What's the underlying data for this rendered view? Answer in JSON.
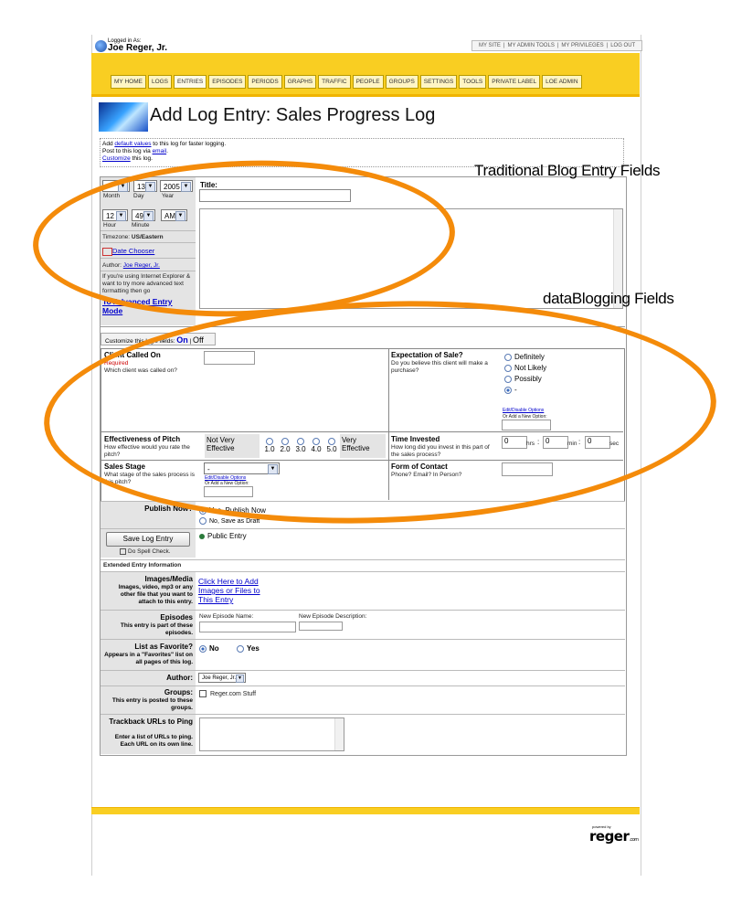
{
  "header": {
    "logged_in_label": "Logged in As:",
    "username": "Joe Reger, Jr.",
    "links": [
      "MY SITE",
      "MY ADMIN TOOLS",
      "MY PRIVILEGES",
      "LOG OUT"
    ]
  },
  "nav": {
    "tabs": [
      "MY HOME",
      "LOGS",
      "ENTRIES",
      "EPISODES",
      "PERIODS",
      "GRAPHS",
      "TRAFFIC",
      "PEOPLE",
      "GROUPS",
      "SETTINGS",
      "TOOLS",
      "PRIVATE LABEL",
      "LOE ADMIN"
    ],
    "active": "ENTRIES"
  },
  "page_title": "Add Log Entry: Sales Progress Log",
  "info": {
    "line1_pre": "Add ",
    "line1_link": "default values",
    "line1_post": " to this log for faster logging.",
    "line2_pre": "Post to this log via ",
    "line2_link": "email",
    "line2_post": ".",
    "line3_link": "Customize",
    "line3_post": " this log."
  },
  "datetime": {
    "month_value": "",
    "day_value": "13",
    "year_value": "2005",
    "month_label": "Month",
    "day_label": "Day",
    "year_label": "Year",
    "hour_value": "12",
    "minute_value": "49",
    "ampm_value": "AM",
    "hour_label": "Hour",
    "minute_label": "Minute",
    "timezone_label": "Timezone:",
    "timezone_value": "US/Eastern",
    "date_chooser": "Date Chooser",
    "author_label": "Author:",
    "author_value": "Joe Reger, Jr.",
    "ie_note": "If you're using Internet Explorer & want to try more advanced text formatting then go",
    "advanced_link": "To Advanced Entry Mode"
  },
  "title_field": {
    "label": "Title:",
    "value": ""
  },
  "customize_fields": {
    "label": "Customize this log's fields:",
    "on": "On",
    "separator": "|",
    "off": "Off"
  },
  "fields": {
    "client_called": {
      "label": "Client Called On",
      "required": "Required",
      "desc": "Which client was called on?"
    },
    "expectation": {
      "label": "Expectation of Sale?",
      "desc": "Do you believe this client will make a purchase?",
      "options": [
        "Definitely",
        "Not Likely",
        "Possibly",
        "-"
      ],
      "selected": "-",
      "edit_link": "Edit/Disable Options",
      "add_label": "Or Add a New Option:"
    },
    "effectiveness": {
      "label": "Effectiveness of Pitch",
      "desc": "How effective would you rate the pitch?",
      "low_label": "Not Very Effective",
      "high_label": "Very Effective",
      "scale": [
        "1.0",
        "2.0",
        "3.0",
        "4.0",
        "5.0"
      ]
    },
    "time_invested": {
      "label": "Time Invested",
      "desc": "How long did you invest in this part of the sales process?",
      "hrs_value": "0",
      "hrs_unit": "hrs",
      "min_value": "0",
      "min_unit": "min",
      "sec_value": "0",
      "sec_unit": "sec",
      "sep": ":"
    },
    "sales_stage": {
      "label": "Sales Stage",
      "desc": "What stage of the sales process is this pitch?",
      "value": "-",
      "edit_link": "Edit/Disable Options",
      "add_label": "Or Add a New Option:"
    },
    "form_of_contact": {
      "label": "Form of Contact",
      "desc": "Phone? Email? In Person?"
    }
  },
  "publish": {
    "label": "Publish Now?",
    "option_yes": "Yes, Publish Now",
    "option_no": "No, Save as Draft",
    "selected": "yes"
  },
  "save": {
    "button": "Save Log Entry",
    "spell_check": "Do Spell Check.",
    "public_entry": "Public Entry"
  },
  "extended": {
    "header": "Extended Entry Information",
    "images": {
      "label": "Images/Media",
      "desc": "Images, video, mp3 or any other file that you want to attach to this entry.",
      "link": "Click Here to Add Images or Files to This Entry"
    },
    "episodes": {
      "label": "Episodes",
      "desc": "This entry is part of these episodes.",
      "new_name_label": "New Episode Name:",
      "new_desc_label": "New Episode Description:"
    },
    "favorite": {
      "label": "List as Favorite?",
      "desc": "Appears in a \"Favorites\" list on all pages of this log.",
      "no": "No",
      "yes": "Yes",
      "selected": "No"
    },
    "author": {
      "label": "Author:",
      "value": "Joe Reger, Jr."
    },
    "groups": {
      "label": "Groups:",
      "desc": "This entry is posted to these groups.",
      "item": "Reger.com Stuff"
    },
    "trackback": {
      "label": "Trackback URLs to Ping",
      "desc": "Enter a list of URLs to ping. Each URL on its own line."
    }
  },
  "annotations": {
    "traditional": "Traditional Blog Entry Fields",
    "datablogging": "dataBlogging Fields"
  },
  "footer": {
    "powered_by": "powered by",
    "logo": "reger",
    "logo_suffix": ".com"
  },
  "colors": {
    "accent_yellow": "#f9ce22",
    "annotation_orange": "#f48b0a",
    "link_blue": "#0000cc"
  }
}
